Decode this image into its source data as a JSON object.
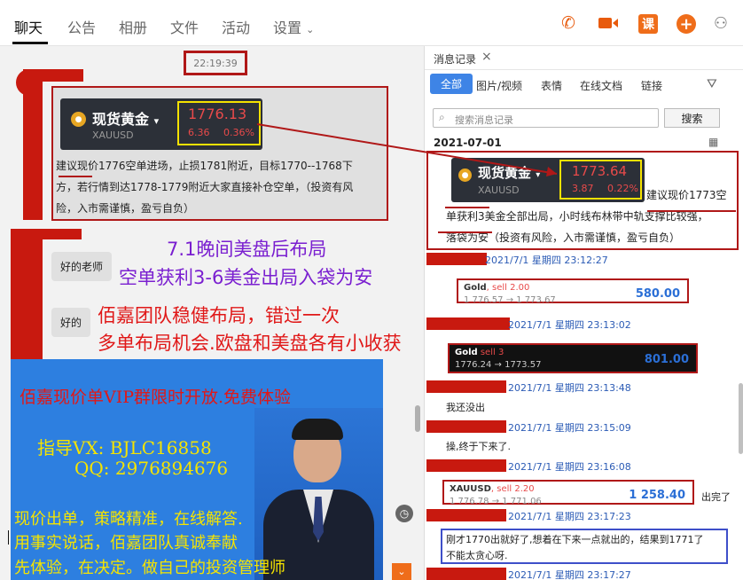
{
  "tabs": [
    "聊天",
    "公告",
    "相册",
    "文件",
    "活动",
    "设置"
  ],
  "top_icons": {
    "call": "phone-icon",
    "video": "video-icon",
    "ke": "课",
    "add": "+"
  },
  "chat": {
    "timestamp": "22:19:39",
    "msg1": {
      "quote_name": "现货黄金",
      "quote_code": "XAUUSD",
      "price": "1776.13",
      "change": "6.36",
      "change_pct": "0.36%",
      "line1": "建议现价1776空单进场，止损1781附近，目标1770--1768下",
      "line2": "方，若行情到达1778-1779附近大家直接补仓空单，（投资有风",
      "line3": "险，入市需谨慎，盈亏自负）"
    },
    "reply1": "好的老师",
    "reply2": "好的",
    "overlay1": "7.1晚间美盘后布局",
    "overlay2": "空单获利3-6美金出局入袋为安",
    "overlay3": "佰嘉团队稳健布局，错过一次",
    "overlay4": "多单布局机会.欧盘和美盘各有小收获",
    "promo": {
      "line1": "佰嘉现价单VIP群限时开放.免费体验",
      "line2": "指导VX:  BJLC16858",
      "line3": "QQ: 2976894676",
      "line4": "现价出单，策略精准，在线解答.",
      "line5": "用事实说话，佰嘉团队真诚奉献",
      "line6": "先体验，在决定。做自己的投资管理师"
    }
  },
  "right": {
    "title": "消息记录",
    "tabs": [
      "全部",
      "图片/视频",
      "表情",
      "在线文档",
      "链接"
    ],
    "search_placeholder": "搜索消息记录",
    "search_btn": "搜索",
    "date": "2021-07-01",
    "msg1": {
      "quote_name": "现货黄金",
      "quote_code": "XAUUSD",
      "price": "1773.64",
      "change": "3.87",
      "change_pct": "0.22%",
      "side_text": "建议现价1773空",
      "line1": "单获利3美金全部出局，小时线布林带中轨支撑比较强，",
      "line2": "落袋为安（投资有风险，入市需谨慎，盈亏自负）"
    },
    "times": [
      "2021/7/1 星期四 23:12:27",
      "2021/7/1 星期四 23:13:02",
      "2021/7/1 星期四 23:13:48",
      "2021/7/1 星期四 23:15:09",
      "2021/7/1 星期四 23:16:08",
      "2021/7/1 星期四 23:17:23",
      "2021/7/1 星期四 23:17:27"
    ],
    "trade1": {
      "sym": "Gold",
      "sell": ", sell 2.00",
      "sub": "1 776.57 → 1 773.67",
      "val": "580.00"
    },
    "trade2": {
      "sym": "Gold",
      "sell": " sell 3",
      "sub": "1776.24 → 1773.57",
      "val": "801.00"
    },
    "trade3": {
      "sym": "XAUUSD",
      "sell": ", sell 2.20",
      "sub": "1 776.78 → 1 771.06",
      "val": "1 258.40"
    },
    "text1": "我还没出",
    "text2": "操,终于下来了.",
    "text3": "出完了",
    "text4a": "刚才1770出就好了,想着在下来一点就出的，结果到1771了",
    "text4b": "不能太贪心呀."
  },
  "colors": {
    "accent": "#ef6d1a",
    "annotation_red": "#b01818",
    "blue_tab": "#3e84e6",
    "promo_blue": "#2d7fe0"
  }
}
